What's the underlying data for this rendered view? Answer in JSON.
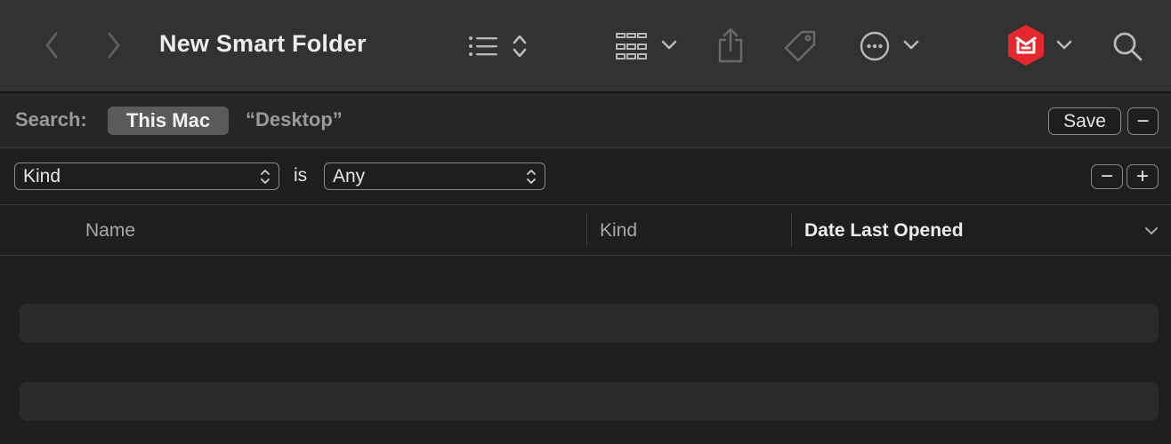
{
  "toolbar": {
    "title": "New Smart Folder",
    "icons": [
      "back-chevron",
      "forward-chevron",
      "list-view",
      "sort-arrows",
      "icon-grid",
      "share",
      "tag",
      "more-ellipsis",
      "app-extension",
      "search"
    ],
    "accent": "#e5282d"
  },
  "search_bar": {
    "label": "Search:",
    "scope_active": "This Mac",
    "scope_other": "“Desktop”",
    "save_label": "Save",
    "remove_symbol": "−"
  },
  "criteria": {
    "attribute": "Kind",
    "operator": "is",
    "value": "Any",
    "remove_symbol": "−",
    "add_symbol": "+"
  },
  "columns": {
    "name": "Name",
    "kind": "Kind",
    "date": "Date Last Opened"
  }
}
